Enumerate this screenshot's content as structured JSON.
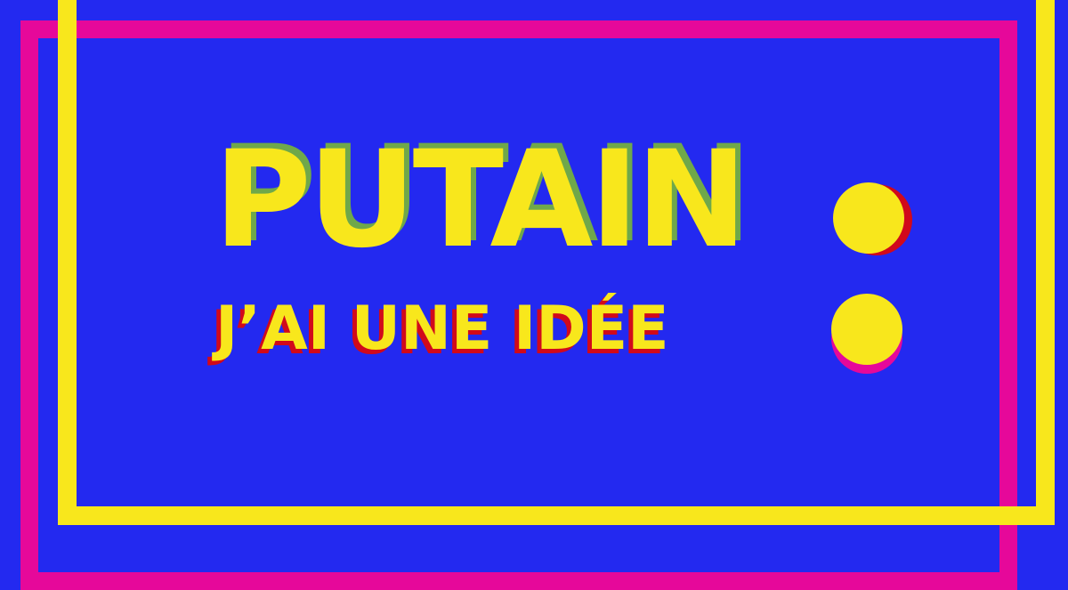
{
  "headline": "PUTAIN",
  "subheadline": "J’AI UNE IDÉE",
  "colors": {
    "background": "#2329f0",
    "yellow": "#f8e71c",
    "pink": "#e6089a",
    "red": "#d1091b",
    "green": "#6fa84a"
  }
}
